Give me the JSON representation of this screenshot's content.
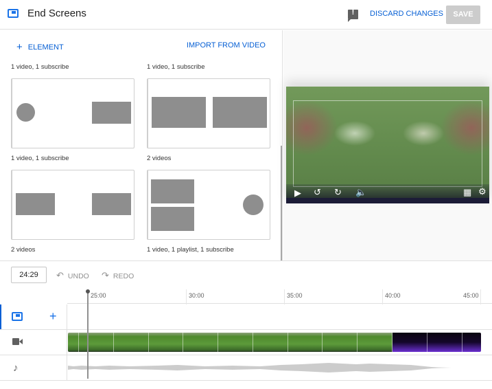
{
  "header": {
    "title": "End Screens",
    "logo_icon": "end-screen-icon",
    "feedback_icon": "feedback-icon",
    "discard_label": "DISCARD CHANGES",
    "save_label": "SAVE"
  },
  "templates_panel": {
    "add_element_label": "ELEMENT",
    "add_icon": "plus-icon",
    "import_label": "IMPORT FROM VIDEO",
    "top_labels": [
      "1 video, 1 subscribe",
      "1 video, 1 subscribe"
    ],
    "templates": [
      {
        "label": "1 video, 1 subscribe",
        "layout": "subscribe-left-video-right"
      },
      {
        "label": "2 videos",
        "layout": "two-large-videos"
      },
      {
        "label": "2 videos",
        "layout": "two-small-videos-edges"
      },
      {
        "label": "1 video, 1 playlist, 1 subscribe",
        "layout": "stacked-videos-subscribe-right"
      }
    ]
  },
  "preview": {
    "controls": [
      "play-icon",
      "rewind-10-icon",
      "forward-10-icon",
      "volume-icon",
      "grid-icon",
      "settings-icon"
    ]
  },
  "timeline": {
    "current_time": "24:29",
    "undo_label": "UNDO",
    "redo_label": "REDO",
    "ticks": [
      "25:00",
      "30:00",
      "35:00",
      "40:00",
      "45:00"
    ],
    "tracks": [
      {
        "name": "end-screen",
        "icon": "end-screen-icon",
        "action_icon": "plus-icon"
      },
      {
        "name": "video",
        "icon": "video-camera-icon"
      },
      {
        "name": "audio",
        "icon": "music-note-icon"
      }
    ],
    "colors": {
      "accent": "#065fd4",
      "video_green": "#5c9a3a",
      "end_purple": "#6a2fd0",
      "waveform": "#cccccc"
    }
  }
}
